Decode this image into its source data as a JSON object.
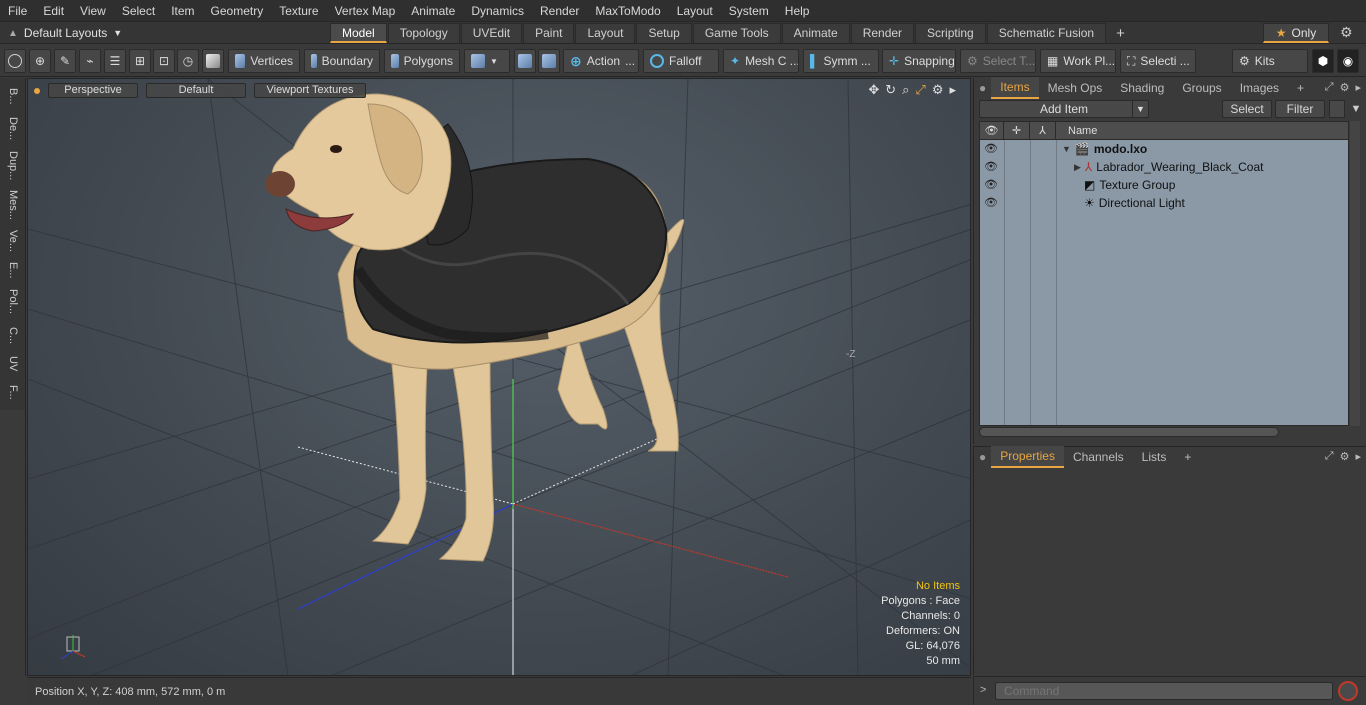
{
  "menu": [
    "File",
    "Edit",
    "View",
    "Select",
    "Item",
    "Geometry",
    "Texture",
    "Vertex Map",
    "Animate",
    "Dynamics",
    "Render",
    "MaxToModo",
    "Layout",
    "System",
    "Help"
  ],
  "layout_select": "Default Layouts",
  "tabs": [
    "Model",
    "Topology",
    "UVEdit",
    "Paint",
    "Layout",
    "Setup",
    "Game Tools",
    "Animate",
    "Render",
    "Scripting",
    "Schematic Fusion"
  ],
  "only_label": "Only",
  "toolbar": {
    "vertices": "Vertices",
    "boundary": "Boundary",
    "polygons": "Polygons",
    "action": "Action",
    "falloff": "Falloff",
    "mesh": "Mesh C ...",
    "symm": "Symm ...",
    "snapping": "Snapping",
    "select_t": "Select T...",
    "workpl": "Work Pl...",
    "selecti": "Selecti ...",
    "kits": "Kits"
  },
  "side_tabs": [
    "B...",
    "De...",
    "Dup...",
    "Mes...",
    "Ve...",
    "E...",
    "Pol...",
    "C...",
    "UV",
    "F..."
  ],
  "viewport": {
    "perspective": "Perspective",
    "default": "Default",
    "textures": "Viewport Textures",
    "minus_z": "-Z",
    "info": {
      "no_items": "No Items",
      "polygons": "Polygons : Face",
      "channels": "Channels: 0",
      "deformers": "Deformers: ON",
      "gl": "GL: 64,076",
      "scale": "50 mm"
    }
  },
  "status": {
    "position": "Position X, Y, Z:  408 mm, 572 mm, 0 m"
  },
  "items_panel": {
    "tabs": [
      "Items",
      "Mesh Ops",
      "Shading",
      "Groups",
      "Images"
    ],
    "add_item": "Add Item",
    "select": "Select",
    "filter": "Filter",
    "name_col": "Name",
    "rows": [
      {
        "label": "modo.lxo"
      },
      {
        "label": "Labrador_Wearing_Black_Coat"
      },
      {
        "label": "Texture Group"
      },
      {
        "label": "Directional Light"
      }
    ]
  },
  "props_panel": {
    "tabs": [
      "Properties",
      "Channels",
      "Lists"
    ]
  },
  "command": {
    "placeholder": "Command"
  },
  "colors": {
    "accent": "#e8a542",
    "tree_bg": "#8b98a6",
    "info_highlight": "#f1c40f"
  }
}
